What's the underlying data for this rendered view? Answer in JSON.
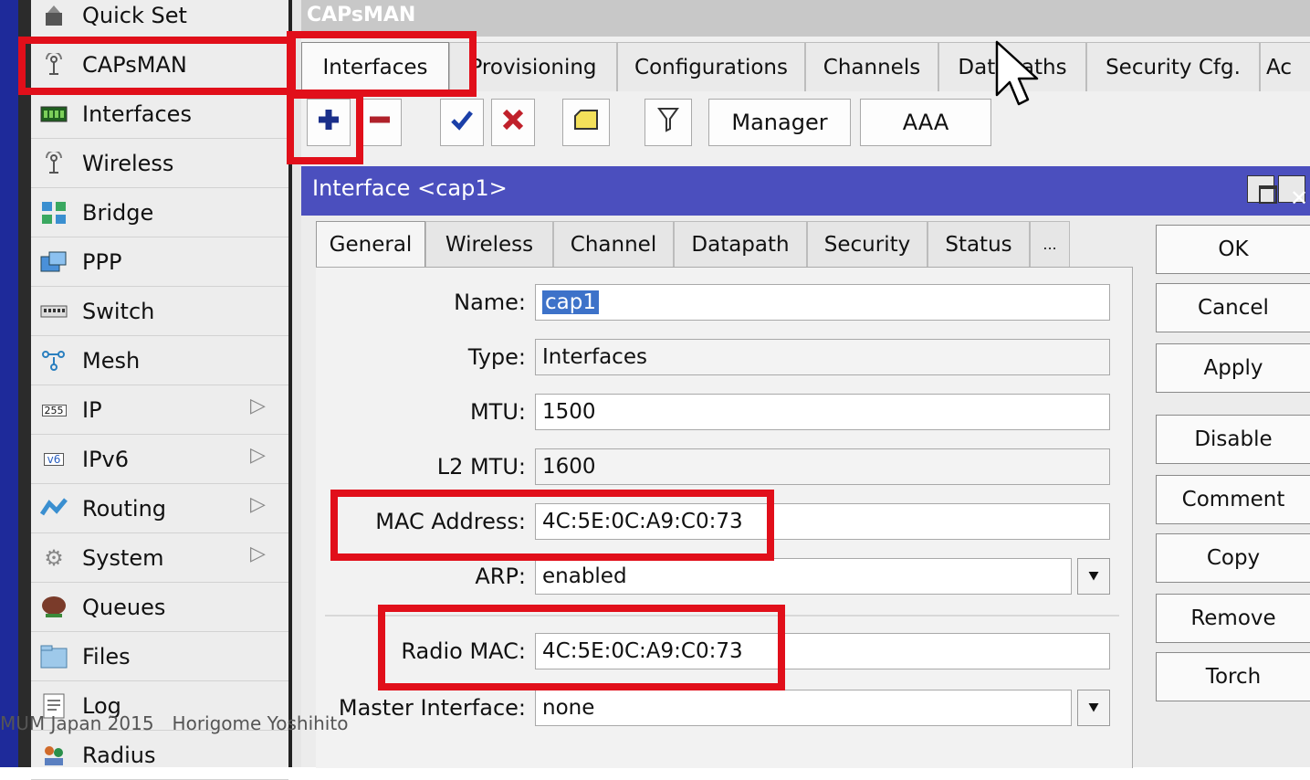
{
  "sidebar": {
    "items": [
      {
        "label": "Quick Set",
        "icon": "quick-set-icon"
      },
      {
        "label": "CAPsMAN",
        "icon": "antenna-icon"
      },
      {
        "label": "Interfaces",
        "icon": "interfaces-icon"
      },
      {
        "label": "Wireless",
        "icon": "antenna-icon"
      },
      {
        "label": "Bridge",
        "icon": "bridge-icon"
      },
      {
        "label": "PPP",
        "icon": "ppp-icon"
      },
      {
        "label": "Switch",
        "icon": "switch-icon"
      },
      {
        "label": "Mesh",
        "icon": "mesh-icon"
      },
      {
        "label": "IP",
        "icon": "ip-icon",
        "icon_text": "255",
        "submenu": true
      },
      {
        "label": "IPv6",
        "icon": "ipv6-icon",
        "icon_text": "v6",
        "submenu": true
      },
      {
        "label": "Routing",
        "icon": "routing-icon",
        "submenu": true
      },
      {
        "label": "System",
        "icon": "gear-icon",
        "submenu": true
      },
      {
        "label": "Queues",
        "icon": "queues-icon"
      },
      {
        "label": "Files",
        "icon": "folder-icon"
      },
      {
        "label": "Log",
        "icon": "log-icon"
      },
      {
        "label": "Radius",
        "icon": "radius-icon"
      }
    ]
  },
  "main": {
    "title": "CAPsMAN",
    "tabs": [
      "Interfaces",
      "Provisioning",
      "Configurations",
      "Channels",
      "Datapaths",
      "Security Cfg.",
      "Ac"
    ],
    "toolbar": {
      "manager": "Manager",
      "aaa": "AAA"
    }
  },
  "dialog": {
    "title": "Interface <cap1>",
    "tabs": [
      "General",
      "Wireless",
      "Channel",
      "Datapath",
      "Security",
      "Status",
      "..."
    ],
    "fields": {
      "name_label": "Name:",
      "name": "cap1",
      "type_label": "Type:",
      "type": "Interfaces",
      "mtu_label": "MTU:",
      "mtu": "1500",
      "l2mtu_label": "L2 MTU:",
      "l2mtu": "1600",
      "mac_label": "MAC Address:",
      "mac": "4C:5E:0C:A9:C0:73",
      "arp_label": "ARP:",
      "arp": "enabled",
      "radio_mac_label": "Radio MAC:",
      "radio_mac": "4C:5E:0C:A9:C0:73",
      "master_label": "Master Interface:",
      "master": "none"
    },
    "buttons": [
      "OK",
      "Cancel",
      "Apply",
      "Disable",
      "Comment",
      "Copy",
      "Remove",
      "Torch"
    ]
  },
  "footer": "MUM Japan 2015　Horigome Yoshihito",
  "colors": {
    "highlight": "#e10f1a",
    "title_bar": "#4b4fbe",
    "selection": "#3d72c9"
  }
}
